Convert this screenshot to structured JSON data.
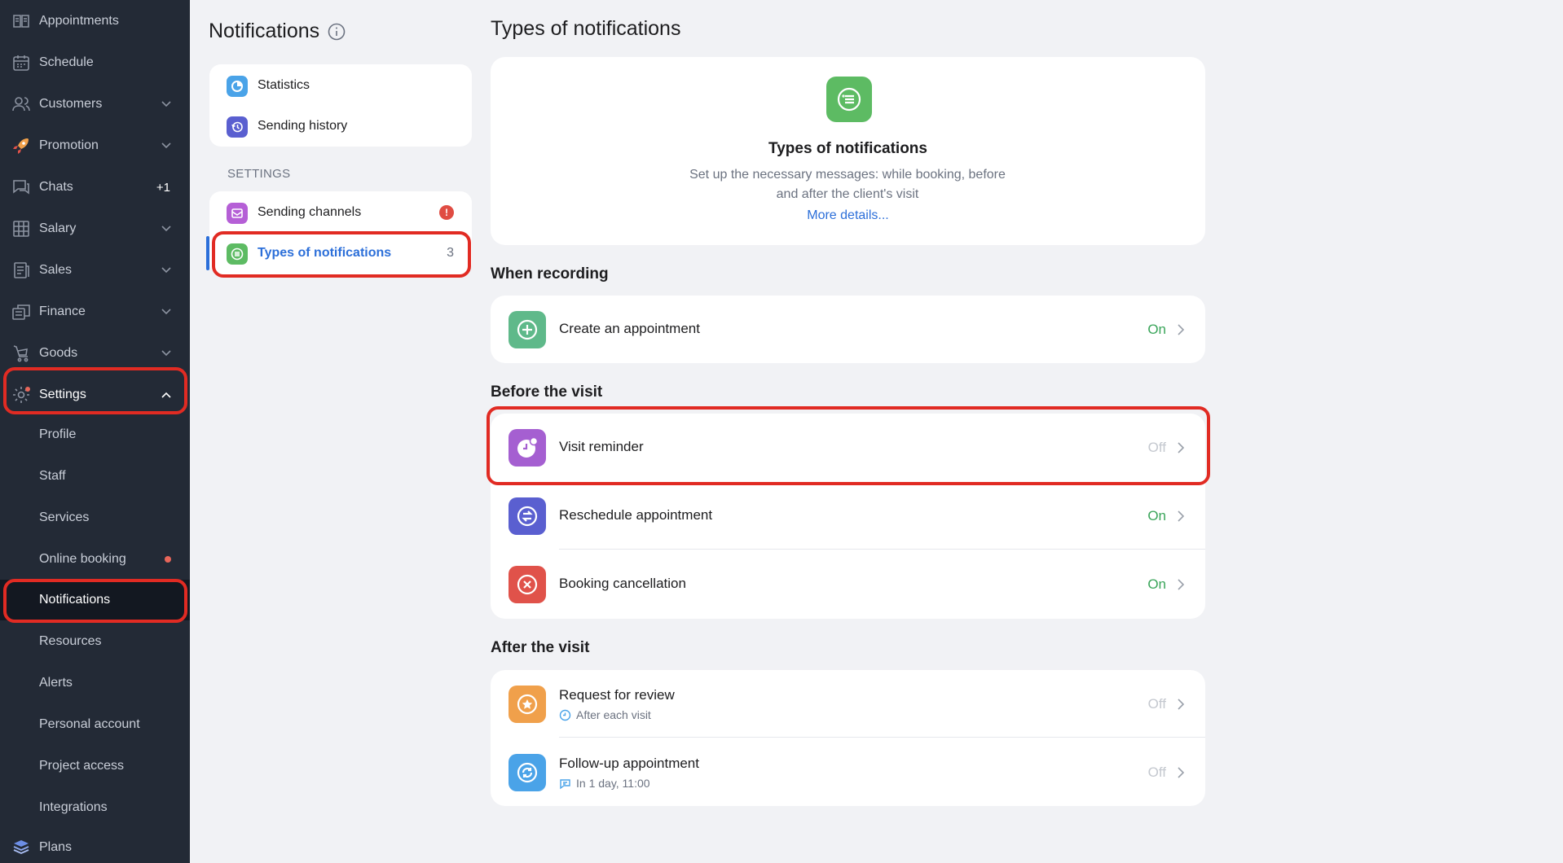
{
  "sidebar": {
    "items": [
      {
        "label": "Appointments",
        "icon": "appointments-icon"
      },
      {
        "label": "Schedule",
        "icon": "calendar-icon"
      },
      {
        "label": "Customers",
        "icon": "customers-icon"
      },
      {
        "label": "Promotion",
        "icon": "rocket-icon"
      },
      {
        "label": "Chats",
        "icon": "chat-icon",
        "badge": "+1"
      },
      {
        "label": "Salary",
        "icon": "salary-icon"
      },
      {
        "label": "Sales",
        "icon": "sales-icon"
      },
      {
        "label": "Finance",
        "icon": "finance-icon"
      },
      {
        "label": "Goods",
        "icon": "goods-icon"
      },
      {
        "label": "Settings",
        "icon": "gear-icon"
      }
    ],
    "settings_sub": [
      {
        "label": "Profile"
      },
      {
        "label": "Staff"
      },
      {
        "label": "Services"
      },
      {
        "label": "Online booking"
      },
      {
        "label": "Notifications"
      },
      {
        "label": "Resources"
      },
      {
        "label": "Alerts"
      },
      {
        "label": "Personal account"
      },
      {
        "label": "Project access"
      },
      {
        "label": "Integrations"
      }
    ],
    "plans_label": "Plans"
  },
  "secondary": {
    "title": "Notifications",
    "top_items": [
      {
        "label": "Statistics"
      },
      {
        "label": "Sending history"
      }
    ],
    "settings_label": "SETTINGS",
    "settings_items": [
      {
        "label": "Sending channels",
        "alert": "!"
      },
      {
        "label": "Types of notifications",
        "count": "3"
      }
    ]
  },
  "main": {
    "title": "Types of notifications",
    "intro": {
      "heading": "Types of notifications",
      "description": "Set up the necessary messages: while booking, before and after the client's visit",
      "link": "More details..."
    },
    "groups": [
      {
        "title": "When recording",
        "items": [
          {
            "label": "Create an appointment",
            "status": "On",
            "color": "#5fb98a"
          }
        ]
      },
      {
        "title": "Before the visit",
        "items": [
          {
            "label": "Visit reminder",
            "status": "Off",
            "color": "#a55fd1"
          },
          {
            "label": "Reschedule appointment",
            "status": "On",
            "color": "#5a5fd0"
          },
          {
            "label": "Booking cancellation",
            "status": "On",
            "color": "#e0524a"
          }
        ]
      },
      {
        "title": "After the visit",
        "items": [
          {
            "label": "Request for review",
            "status": "Off",
            "sub": "After each visit",
            "color": "#f0a04b"
          },
          {
            "label": "Follow-up appointment",
            "status": "Off",
            "sub": "In 1 day, 11:00",
            "color": "#4aa3e8"
          }
        ]
      }
    ]
  },
  "colors": {
    "sidebar_bg": "#232a36",
    "accent_blue": "#2c6fd9",
    "status_on": "#3aa55a",
    "status_off": "#c4c8cf",
    "highlight_red": "#e12b23"
  }
}
